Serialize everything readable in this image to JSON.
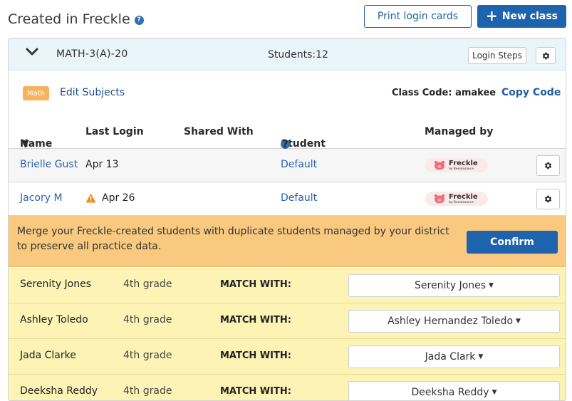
{
  "header": {
    "title": "Created in Freckle",
    "print_button": "Print login cards",
    "new_class_button": "New class"
  },
  "class": {
    "name": "MATH-3(A)-20",
    "students": "Students:12",
    "login_steps": "Login Steps",
    "subject_badge": "Math",
    "edit_subjects": "Edit Subjects",
    "class_code_label": "Class Code: amakee",
    "copy_code": "Copy Code"
  },
  "table": {
    "columns": {
      "name": "Name",
      "last_login": "Last Login",
      "shared_with": "Shared With",
      "student_settings": "Student Settings",
      "managed_by": "Managed by"
    },
    "rows": [
      {
        "name": "Brielle Gust",
        "last_login": "Apr 13",
        "shared_with": "",
        "settings": "Default",
        "managed_by": "Freckle",
        "managed_sub": "by Renaissance"
      },
      {
        "name": "Jacory M",
        "last_login": "Apr 26",
        "shared_with": "",
        "settings": "Default",
        "managed_by": "Freckle",
        "managed_sub": "by Renaissance"
      }
    ]
  },
  "merge": {
    "message": "Merge your Freckle-created students with duplicate students managed by your district to preserve all practice data.",
    "confirm": "Confirm",
    "match_label": "MATCH WITH:",
    "rows": [
      {
        "name": "Serenity Jones",
        "grade": "4th grade",
        "match": "Serenity Jones"
      },
      {
        "name": "Ashley Toledo",
        "grade": "4th grade",
        "match": "Ashley Hernandez Toledo"
      },
      {
        "name": "Jada Clarke",
        "grade": "4th grade",
        "match": "Jada Clark"
      },
      {
        "name": "Deeksha Reddy",
        "grade": "4th grade",
        "match": "Deeksha Reddy"
      }
    ]
  },
  "colors": {
    "primary": "#1e63ad",
    "link": "#2b65a8",
    "banner": "#f8c97f",
    "match_row": "#fcf3b5",
    "math_badge": "#f6b35d",
    "header_bg": "#eaf4fb"
  }
}
